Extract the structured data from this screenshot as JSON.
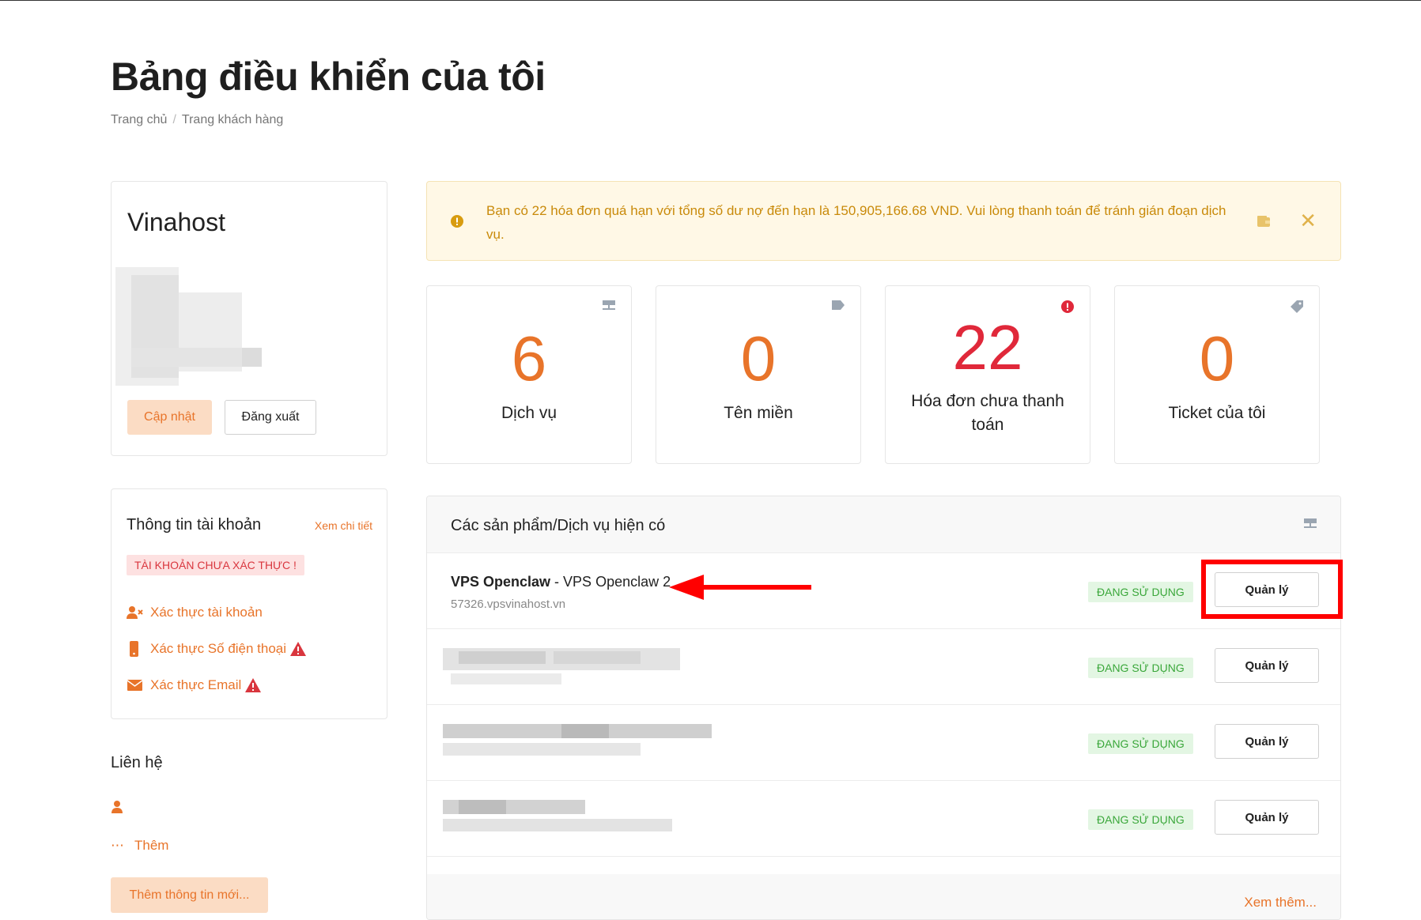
{
  "page": {
    "title": "Bảng điều khiển của tôi",
    "breadcrumb": [
      "Trang chủ",
      "Trang khách hàng"
    ]
  },
  "profile": {
    "name": "Vinahost",
    "update_label": "Cập nhật",
    "logout_label": "Đăng xuất"
  },
  "account": {
    "title": "Thông tin tài khoản",
    "view_detail": "Xem chi tiết",
    "unverified_badge": "TÀI KHOẢN CHƯA XÁC THỰC !",
    "verify_account": "Xác thực tài khoản",
    "verify_phone": "Xác thực Số điện thoại",
    "verify_email": "Xác thực Email"
  },
  "contact": {
    "title": "Liên hệ",
    "more_label": "Thêm",
    "add_new_label": "Thêm thông tin mới..."
  },
  "alert": {
    "message": "Bạn có 22 hóa đơn quá hạn với tổng số dư nợ đến hạn là 150,905,166.68 VND. Vui lòng thanh toán để tránh gián đoạn dịch vụ."
  },
  "stats": [
    {
      "value": "6",
      "label": "Dịch vụ",
      "icon": "server-icon"
    },
    {
      "value": "0",
      "label": "Tên miền",
      "icon": "tag-icon"
    },
    {
      "value": "22",
      "label": "Hóa đơn chưa thanh toán",
      "icon": "alert-circle-icon"
    },
    {
      "value": "0",
      "label": "Ticket của tôi",
      "icon": "ticket-icon"
    }
  ],
  "services": {
    "title": "Các sản phẩm/Dịch vụ hiện có",
    "status_label": "ĐANG SỬ DỤNG",
    "manage_label": "Quản lý",
    "view_more": "Xem thêm...",
    "first_item": {
      "product": "VPS Openclaw",
      "separator": " - ",
      "name": "VPS Openclaw 2",
      "domain": "57326.vpsvinahost.vn"
    }
  },
  "colors": {
    "accent": "#e8742a",
    "danger": "#e0283a",
    "success": "#3aa73a",
    "annotation": "#ff0000"
  }
}
